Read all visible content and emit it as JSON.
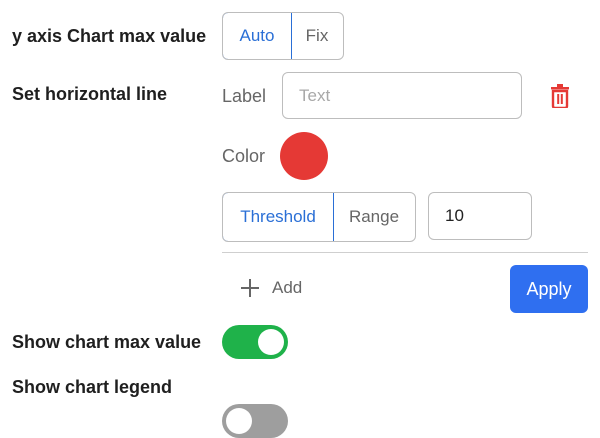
{
  "y_axis": {
    "label": "y axis Chart max value",
    "options": [
      "Auto",
      "Fix"
    ],
    "selected": "Auto"
  },
  "horizontal_line": {
    "label": "Set horizontal line",
    "label_field_title": "Label",
    "label_placeholder": "Text",
    "label_value": "",
    "color_title": "Color",
    "color": "#e53935",
    "mode_options": [
      "Threshold",
      "Range"
    ],
    "mode_selected": "Threshold",
    "value": "10",
    "delete_icon": "trash-icon",
    "delete_icon_color": "#e53935"
  },
  "actions": {
    "add_label": "Add",
    "add_icon": "plus-icon",
    "apply_label": "Apply",
    "apply_color": "#2f6ff0"
  },
  "toggles": {
    "max_value": {
      "label": "Show chart max value",
      "on": true,
      "on_color": "#1fb24a"
    },
    "legend": {
      "label": "Show chart legend",
      "on": false,
      "off_color": "#9e9e9e"
    }
  }
}
